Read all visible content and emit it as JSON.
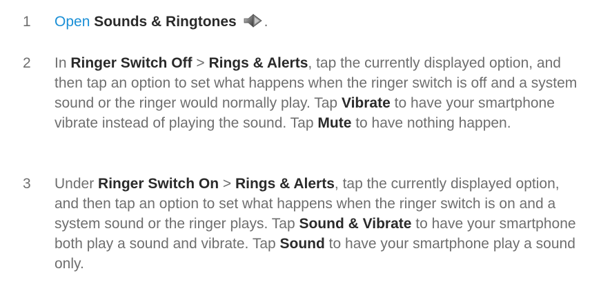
{
  "steps": [
    {
      "number": "1",
      "open_link": "Open",
      "sounds_title": "Sounds & Ringtones",
      "icon": "sounds-ringtones-speaker-icon",
      "trailing": "."
    },
    {
      "number": "2",
      "p1": "In ",
      "b1": "Ringer Switch Off",
      "p2": " > ",
      "b2": "Rings & Alerts",
      "p3": ", tap the currently displayed option, and then tap an option to set what happens when the ringer switch is off and a system sound or the ringer would normally play. Tap ",
      "b3": "Vibrate",
      "p4": " to have your smartphone vibrate instead of playing the sound. Tap ",
      "b4": "Mute",
      "p5": " to have nothing happen."
    },
    {
      "number": "3",
      "p1": "Under ",
      "b1": "Ringer Switch On",
      "p2": " > ",
      "b2": "Rings & Alerts",
      "p3": ", tap the currently displayed option, and then tap an option to set what happens when the ringer switch is on and a system sound or the ringer plays. Tap ",
      "b3": "Sound & Vibrate",
      "p4": " to have your smartphone both play a sound and vibrate. Tap ",
      "b4": "Sound",
      "p5": " to have your smartphone play a sound only."
    }
  ],
  "colors": {
    "body_text": "#6e6e6e",
    "bold_text": "#2a2a2a",
    "link": "#1a8fd6"
  }
}
